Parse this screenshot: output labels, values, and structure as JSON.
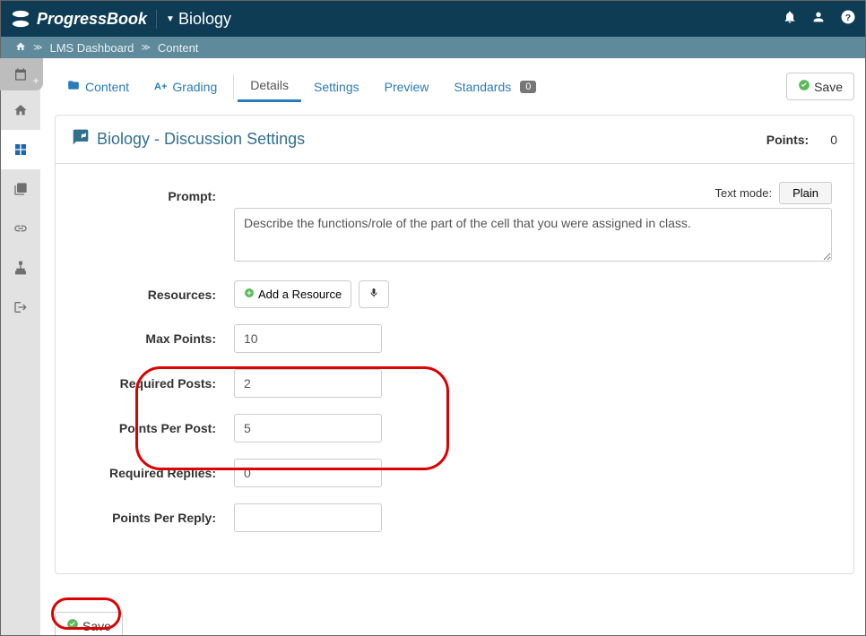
{
  "brand": "ProgressBook",
  "course": "Biology",
  "breadcrumbs": {
    "lms": "LMS Dashboard",
    "current": "Content"
  },
  "tabs": {
    "content": "Content",
    "grading": "Grading",
    "details": "Details",
    "settings": "Settings",
    "preview": "Preview",
    "standards": "Standards",
    "standards_count": "0"
  },
  "buttons": {
    "save": "Save",
    "add_resource": "Add a Resource",
    "plain": "Plain"
  },
  "panel": {
    "title": "Biology - Discussion Settings",
    "points_label": "Points:",
    "points_value": "0"
  },
  "labels": {
    "prompt": "Prompt:",
    "text_mode": "Text mode:",
    "resources": "Resources:",
    "max_points": "Max Points:",
    "required_posts": "Required Posts:",
    "points_per_post": "Points Per Post:",
    "required_replies": "Required Replies:",
    "points_per_reply": "Points Per Reply:"
  },
  "values": {
    "prompt_text": "Describe the functions/role of the part of the cell that you were assigned in class.",
    "max_points": "10",
    "required_posts": "2",
    "points_per_post": "5",
    "required_replies": "0",
    "points_per_reply": ""
  }
}
